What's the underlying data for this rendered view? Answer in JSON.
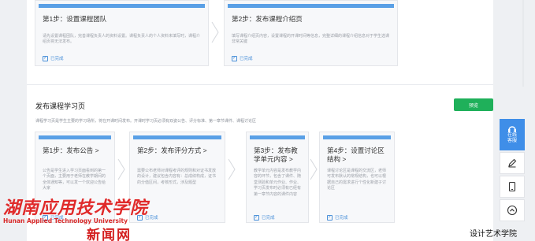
{
  "top_steps": [
    {
      "title": "第1步：设置课程团队",
      "desc": "请先设置课程团队，完善课程负责人的资料设置。课程负责人的个人资料未填写时，课程介绍页将无法发布。",
      "status": "已完成"
    },
    {
      "title": "第2步：发布课程介绍页",
      "desc": "填写课程介绍页内容，设置课程的开课时间等信息，完整详细的课程介绍信息对于学生选课非常关键",
      "status": "已完成"
    }
  ],
  "section": {
    "title": "发布课程学习页",
    "desc": "课程学习页是学生主要的学习场所，将在开课时间发布。开课时学习页必须有双姿公告、评分标准、第一章节课件、课程讨论区",
    "publish_label": "预览"
  },
  "bottom_steps": [
    {
      "title": "第1步：发布公告 >",
      "desc": "公告是学生进入学习页面看到的第一个页面，主要用于老师在教学期间的全体通知等，可以发一个欢迎公告给大家",
      "status": "已完成"
    },
    {
      "title": "第2步：发布评分方式 >",
      "desc": "需要公布老师对课程考评的规则和对证书发放的设计，建议包含内容有：总成绩构成，证书的分值区间，考核形式，涉及题型",
      "status": "已完成"
    },
    {
      "title": "第3步：发布教学单元内容 >",
      "desc": "教学单元内容是发布教学内容的环节，包含了课件、随堂测验和单元作业、作业、学习页发布时必须有已经有第一章节内容的课件内容",
      "status": "已完成"
    },
    {
      "title": "第4步：设置讨论区结构 >",
      "desc": "课程讨论区是课程的交流区，老师可发布默认的常规结构，也可以根据自己的需求进行个性化新建子讨论区",
      "status": "已完成"
    }
  ],
  "side_tools": {
    "support_label_1": "在线",
    "support_label_2": "客服"
  },
  "watermark": {
    "cn": "湖南应用技术学院",
    "en": "Hunan Applied Technology University",
    "news": "新闻网"
  },
  "credit": "设计艺术学院",
  "colors": {
    "accent_bar": "#5aa0e6",
    "publish_button": "#1fb05a",
    "support_button": "#3f8ee8",
    "done_text": "#4a90d9"
  }
}
